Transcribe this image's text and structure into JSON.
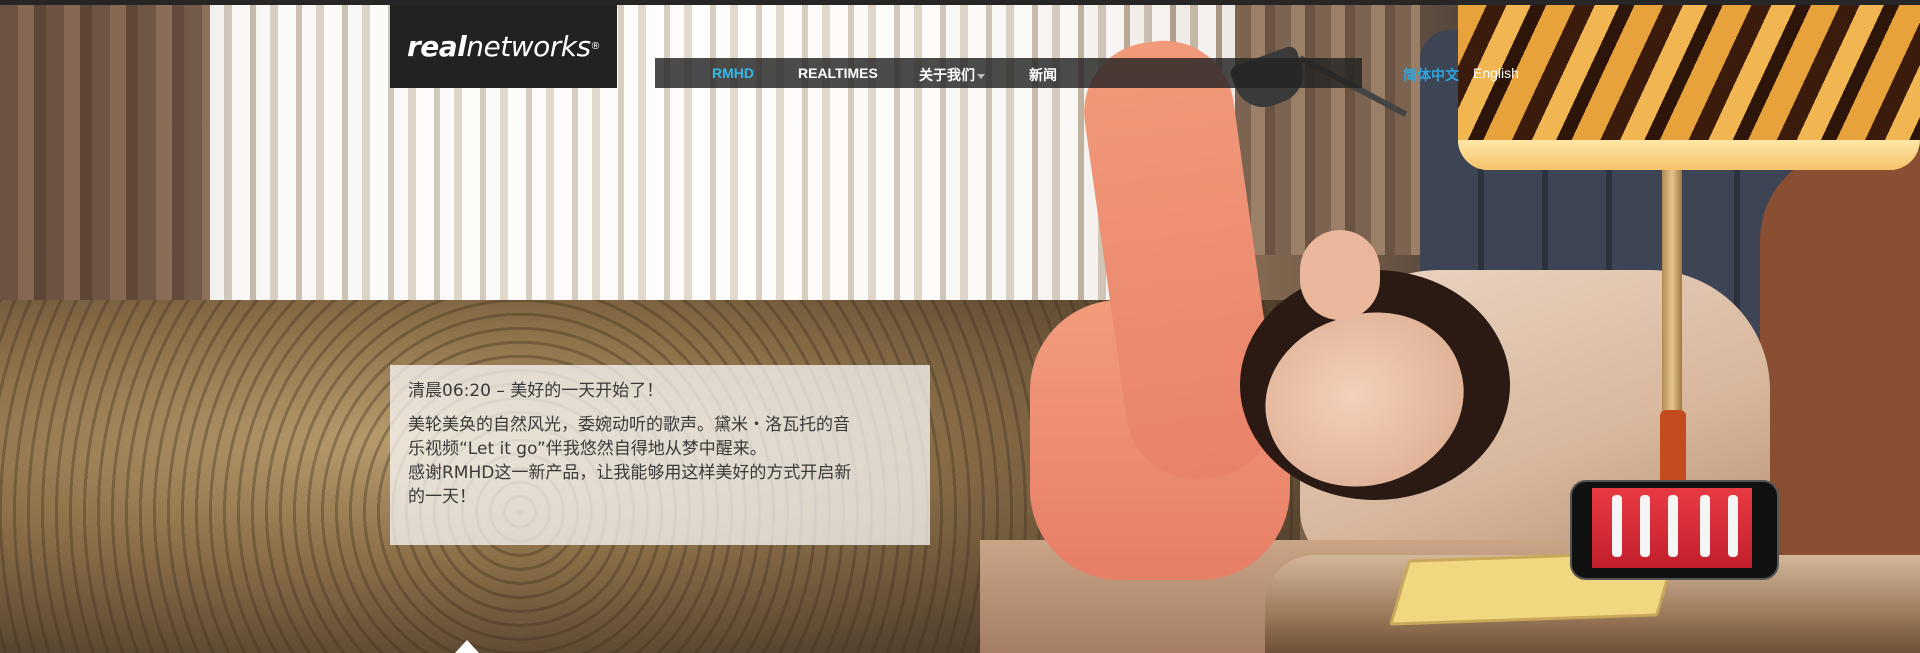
{
  "logo": {
    "strong_text": "real",
    "light_text": "networks",
    "mark": "®"
  },
  "nav": {
    "items": [
      {
        "label": "RMHD",
        "active": true
      },
      {
        "label": "REALTIMES",
        "active": false
      },
      {
        "label": "关于我们",
        "active": false,
        "has_dropdown": true
      },
      {
        "label": "新闻",
        "active": false
      }
    ]
  },
  "language": {
    "chinese": "简体中文",
    "english": "English"
  },
  "caption": {
    "title": "清晨06:20 – 美好的一天开始了！",
    "lines": [
      "美轮美奂的自然风光，委婉动听的歌声。黛米・洛瓦托的音",
      "乐视频“Let it go”伴我悠然自得地从梦中醒来。",
      "感谢RMHD这一新产品，让我能够用这样美好的方式开启新",
      "的一天！"
    ]
  },
  "colors": {
    "nav_active": "#35b8e7",
    "lang_active": "#2ea5df",
    "logo_bg": "#222222"
  }
}
